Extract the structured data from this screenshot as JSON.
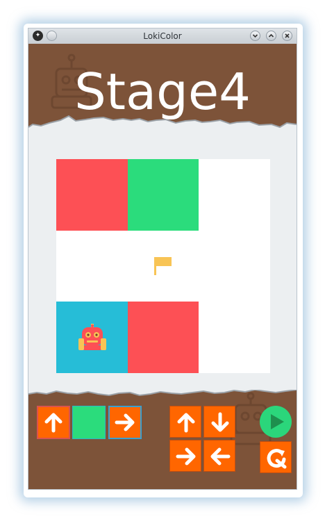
{
  "window": {
    "title": "LokiColor",
    "app_icon": "loki-app-icon"
  },
  "stage": {
    "title": "Stage4"
  },
  "colors": {
    "brown": "#7d5339",
    "red": "#fd5055",
    "green": "#2bdc7c",
    "cyan": "#26bdd7",
    "white": "#ffffff",
    "orange": "#ff6600",
    "flag": "#f8c455",
    "play_green": "#2bd67b"
  },
  "board": {
    "rows": 3,
    "cols": 3,
    "cells": [
      [
        "red",
        "green",
        "white"
      ],
      [
        "white",
        "white",
        "white"
      ],
      [
        "cyan",
        "red",
        "white"
      ]
    ],
    "flag": {
      "row": 1,
      "col": 1,
      "icon": "flag-icon"
    },
    "robot": {
      "row": 2,
      "col": 0,
      "icon": "robot-icon"
    }
  },
  "program_slots": [
    {
      "type": "arrow",
      "icon": "arrow-up-icon"
    },
    {
      "type": "color",
      "color": "green"
    },
    {
      "type": "arrow",
      "icon": "arrow-right-icon"
    }
  ],
  "palette": [
    {
      "icon": "arrow-up-icon"
    },
    {
      "icon": "arrow-down-icon"
    },
    {
      "icon": "arrow-right-icon"
    },
    {
      "icon": "arrow-left-icon"
    }
  ],
  "controls": {
    "play": "play-icon",
    "reset": "restart-icon"
  }
}
